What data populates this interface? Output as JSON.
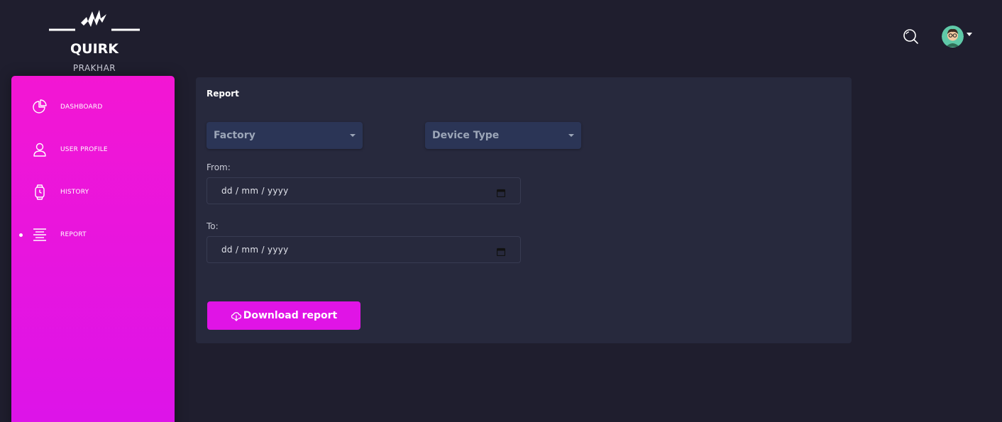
{
  "brand": {
    "name": "QUIRK",
    "user": "PRAKHAR"
  },
  "header": {
    "search_icon": "search-icon",
    "avatar_icon": "user-avatar"
  },
  "sidebar": {
    "items": [
      {
        "label": "DASHBOARD",
        "icon": "pie-chart-icon",
        "active": false
      },
      {
        "label": "USER PROFILE",
        "icon": "user-icon",
        "active": false
      },
      {
        "label": "HISTORY",
        "icon": "watch-icon",
        "active": false
      },
      {
        "label": "REPORT",
        "icon": "align-center-icon",
        "active": true
      }
    ]
  },
  "report": {
    "title": "Report",
    "factory_select": "Factory",
    "device_select": "Device Type",
    "from_label": "From:",
    "from_value": "dd / mm / yyyy",
    "to_label": "To:",
    "to_value": "dd / mm / yyyy",
    "download_label": "Download report"
  },
  "colors": {
    "background": "#1f1e2e",
    "card": "#27293d",
    "accent": "#e014e6",
    "select": "#2b3556"
  }
}
